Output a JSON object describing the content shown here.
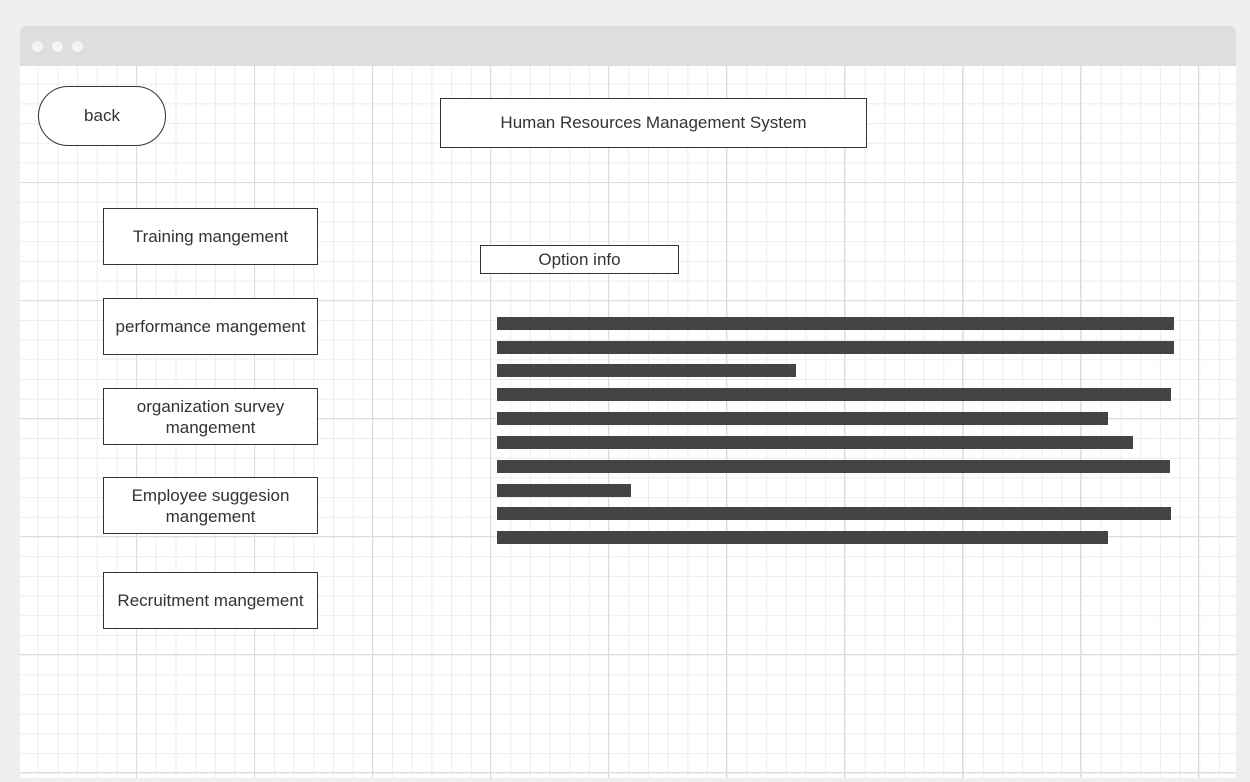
{
  "window": {
    "controls": [
      "window-dot",
      "window-dot",
      "window-dot"
    ]
  },
  "header": {
    "back_label": "back",
    "app_title": "Human Resources Management System"
  },
  "sidebar": {
    "items": [
      {
        "label": "Training mangement"
      },
      {
        "label": "performance mangement"
      },
      {
        "label": "organization survey mangement"
      },
      {
        "label": "Employee suggesion mangement"
      },
      {
        "label": "Recruitment mangement"
      }
    ]
  },
  "main": {
    "option_info_label": "Option info",
    "placeholder_text_lines": 10
  },
  "colors": {
    "page_background": "#efefef",
    "titlebar": "#dedede",
    "border": "#333333",
    "placeholder_bar": "#444444",
    "grid_line": "#dcdcdc"
  }
}
